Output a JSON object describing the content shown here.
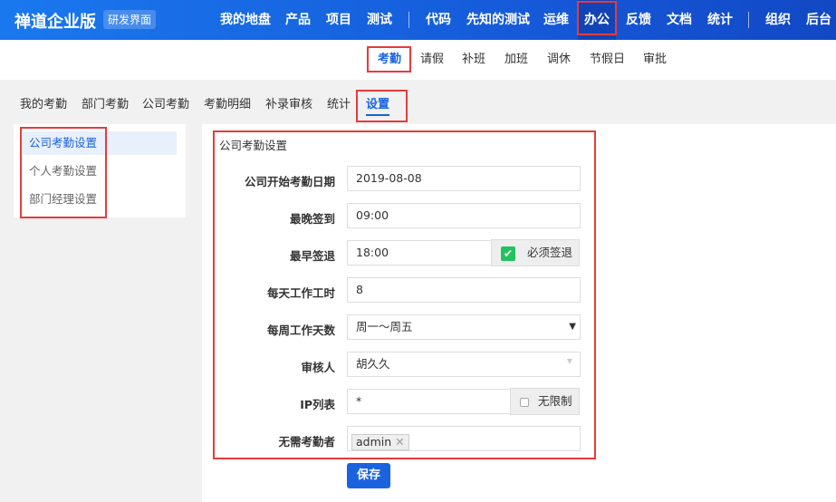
{
  "header": {
    "brand": "禅道企业版",
    "badge": "研发界面",
    "nav": [
      "我的地盘",
      "产品",
      "项目",
      "测试",
      "代码",
      "先知的测试",
      "运维",
      "办公",
      "反馈",
      "文档",
      "统计",
      "组织",
      "后台"
    ],
    "active": "办公"
  },
  "subnav": {
    "items": [
      "考勤",
      "请假",
      "补班",
      "加班",
      "调休",
      "节假日",
      "审批"
    ],
    "active": "考勤"
  },
  "tabs": {
    "items": [
      "我的考勤",
      "部门考勤",
      "公司考勤",
      "考勤明细",
      "补录审核",
      "统计",
      "设置"
    ],
    "active": "设置"
  },
  "sidebar": {
    "items": [
      "公司考勤设置",
      "个人考勤设置",
      "部门经理设置"
    ],
    "active": "公司考勤设置"
  },
  "form": {
    "title": "公司考勤设置",
    "start_date": {
      "label": "公司开始考勤日期",
      "value": "2019-08-08"
    },
    "latest_signin": {
      "label": "最晚签到",
      "value": "09:00"
    },
    "earliest_signout": {
      "label": "最早签退",
      "value": "18:00",
      "checkbox_label": "必须签退",
      "checked": true
    },
    "daily_hours": {
      "label": "每天工作工时",
      "value": "8"
    },
    "weekly_days": {
      "label": "每周工作天数",
      "value": "周一～周五"
    },
    "reviewer": {
      "label": "审核人",
      "value": "胡久久"
    },
    "ip_list": {
      "label": "IP列表",
      "value": "*",
      "checkbox_label": "无限制",
      "checked": false
    },
    "exempt": {
      "label": "无需考勤者",
      "tags": [
        "admin"
      ]
    },
    "save_label": "保存"
  },
  "colors": {
    "accent": "#1a63e0",
    "highlight": "#e53c3c",
    "check": "#22c35e"
  }
}
